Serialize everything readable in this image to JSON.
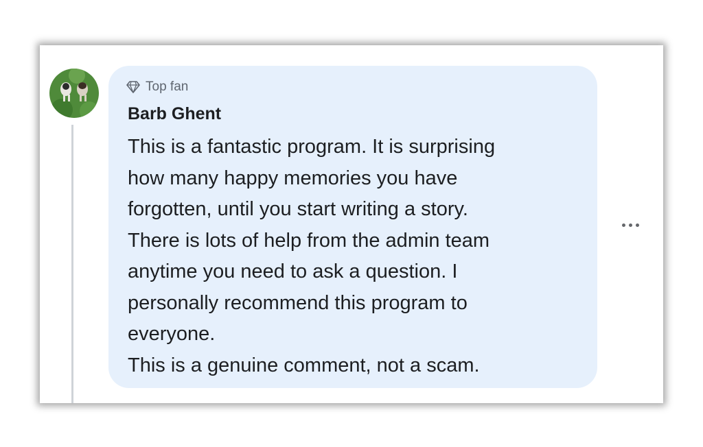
{
  "comment": {
    "badge_label": "Top fan",
    "badge_icon": "diamond-icon",
    "author": "Barb Ghent",
    "avatar_icon": "profile-photo",
    "lines": [
      "This is a fantastic program. It is surprising",
      "how many happy memories you have",
      "forgotten, until you start writing a story.",
      "There is lots of help from the admin team",
      "anytime you need to ask a question. I",
      "personally recommend this program to",
      "everyone.",
      "This is a genuine comment, not a scam."
    ],
    "more_icon": "more-options-icon"
  },
  "colors": {
    "bubble": "#e6f0fc",
    "text": "#1c1e21",
    "muted": "#5f6670",
    "thread_line": "#cfd3d8"
  }
}
